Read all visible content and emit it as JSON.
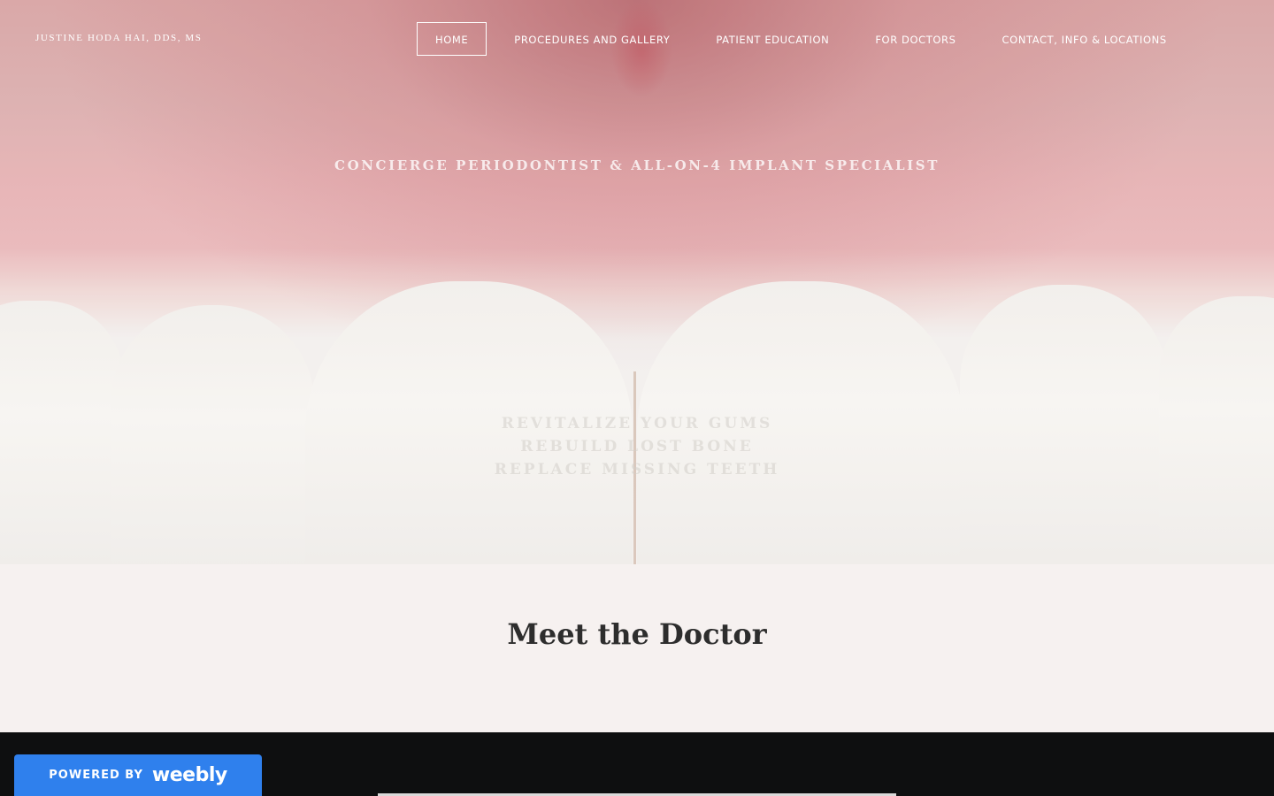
{
  "site": {
    "title": "JUSTINE HODA HAI, DDS, MS"
  },
  "nav": {
    "items": [
      {
        "label": "HOME",
        "active": true
      },
      {
        "label": "PROCEDURES AND GALLERY",
        "active": false
      },
      {
        "label": "PATIENT EDUCATION",
        "active": false
      },
      {
        "label": "FOR DOCTORS",
        "active": false
      },
      {
        "label": "CONTACT, INFO & LOCATIONS",
        "active": false
      }
    ]
  },
  "hero": {
    "tagline": "CONCIERGE PERIODONTIST & ALL-ON-4 IMPLANT SPECIALIST",
    "lines": [
      "REVITALIZE YOUR GUMS",
      "REBUILD LOST BONE",
      "REPLACE MISSING TEETH"
    ]
  },
  "meet": {
    "heading": "Meet the Doctor"
  },
  "badge": {
    "powered_by": "POWERED BY",
    "brand": "weebly"
  },
  "colors": {
    "badge_bg": "#2f80ed",
    "meet_bg": "#f6f1f0",
    "footer_bg": "#0e0f10"
  }
}
